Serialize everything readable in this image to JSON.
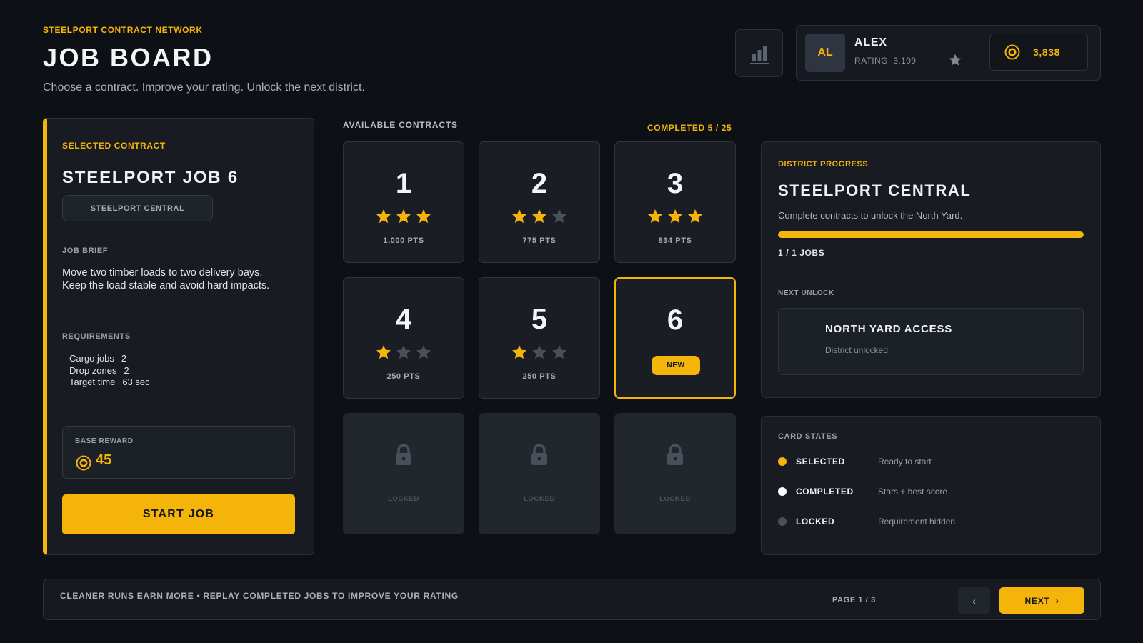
{
  "header": {
    "eyebrow": "STEELPORT CONTRACT NETWORK",
    "title": "JOB BOARD",
    "subtitle": "Choose a contract. Improve your rating. Unlock the next district.",
    "stats_icon": "bar-chart-icon"
  },
  "profile": {
    "initials": "AL",
    "name": "ALEX",
    "rating_label": "RATING",
    "rating_value": "3,109",
    "rank_icon": "star-icon",
    "coins": "3,838",
    "coin_icon": "coin-icon"
  },
  "selected_contract": {
    "eyebrow": "SELECTED CONTRACT",
    "title": "STEELPORT JOB 6",
    "district": "STEELPORT CENTRAL",
    "brief_label": "JOB BRIEF",
    "brief_line1": "Move two timber loads to two delivery bays.",
    "brief_line2": "Keep the load stable and avoid hard impacts.",
    "requirements_label": "REQUIREMENTS",
    "requirements": [
      {
        "key": "Cargo jobs",
        "value": "2"
      },
      {
        "key": "Drop zones",
        "value": "2"
      },
      {
        "key": "Target time",
        "value": "63 sec"
      }
    ],
    "reward_label": "BASE REWARD",
    "reward_value": "45",
    "start_label": "START JOB"
  },
  "grid": {
    "label": "AVAILABLE CONTRACTS",
    "completed": "COMPLETED 5 / 25",
    "cards": [
      {
        "num": "1",
        "stars": 3,
        "pts": "1,000 PTS",
        "state": "completed"
      },
      {
        "num": "2",
        "stars": 2,
        "pts": "775 PTS",
        "state": "completed"
      },
      {
        "num": "3",
        "stars": 3,
        "pts": "834 PTS",
        "state": "completed"
      },
      {
        "num": "4",
        "stars": 1,
        "pts": "250 PTS",
        "state": "completed"
      },
      {
        "num": "5",
        "stars": 1,
        "pts": "250 PTS",
        "state": "completed"
      },
      {
        "num": "6",
        "badge": "NEW",
        "state": "selected"
      },
      {
        "locked_label": "LOCKED",
        "state": "locked"
      },
      {
        "locked_label": "LOCKED",
        "state": "locked"
      },
      {
        "locked_label": "LOCKED",
        "state": "locked"
      }
    ]
  },
  "district": {
    "eyebrow": "DISTRICT PROGRESS",
    "title": "STEELPORT CENTRAL",
    "description": "Complete contracts to unlock the North Yard.",
    "progress": 1.0,
    "jobs": "1 / 1 JOBS",
    "next_label": "NEXT UNLOCK",
    "next_title": "NORTH YARD ACCESS",
    "next_sub": "District unlocked"
  },
  "legend": {
    "label": "CARD STATES",
    "items": [
      {
        "name": "SELECTED",
        "desc": "Ready to start",
        "color": "#f5b40a"
      },
      {
        "name": "COMPLETED",
        "desc": "Stars + best score",
        "color": "#ffffff"
      },
      {
        "name": "LOCKED",
        "desc": "Requirement hidden",
        "color": "#4a505a"
      }
    ]
  },
  "footer": {
    "tip": "CLEANER RUNS EARN MORE  •  REPLAY COMPLETED JOBS TO IMPROVE YOUR RATING",
    "page": "PAGE 1 / 3",
    "prev": "‹",
    "next": "NEXT",
    "next_arrow": "›"
  },
  "colors": {
    "accent": "#f5b40a",
    "background": "#0d1015",
    "panel": "#181b21",
    "star_off": "#4a505a"
  }
}
